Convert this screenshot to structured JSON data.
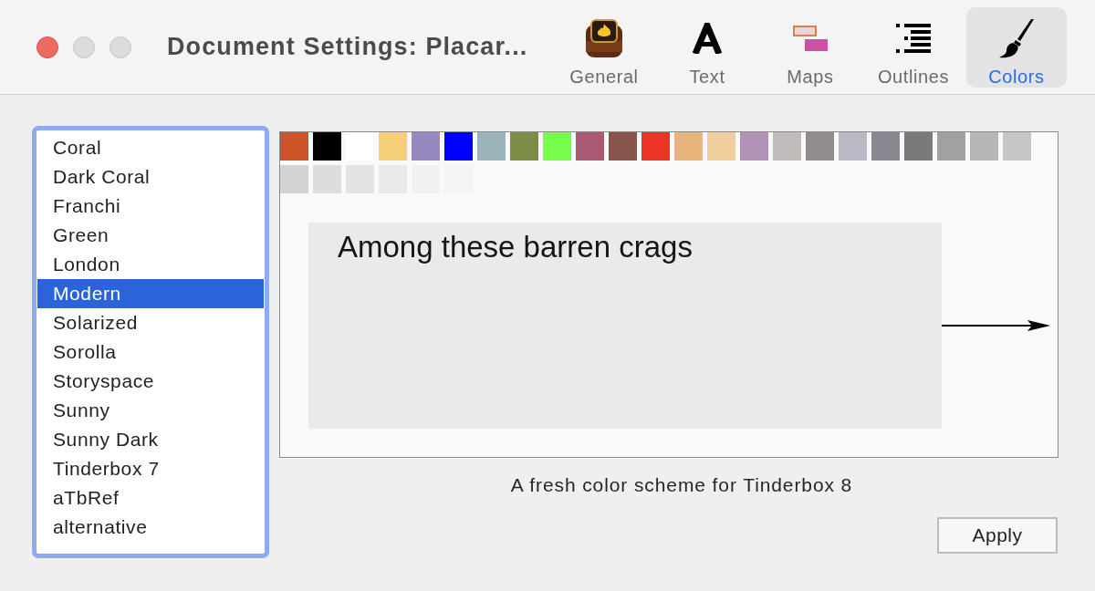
{
  "window": {
    "title": "Document Settings: Placar..."
  },
  "toolbar": {
    "tabs": [
      {
        "label": "General",
        "kind": "app",
        "selected": false
      },
      {
        "label": "Text",
        "kind": "letter",
        "selected": false
      },
      {
        "label": "Maps",
        "kind": "notes",
        "selected": false
      },
      {
        "label": "Outlines",
        "kind": "list",
        "selected": false
      },
      {
        "label": "Colors",
        "kind": "brush",
        "selected": true
      }
    ]
  },
  "scheme_list": {
    "items": [
      {
        "label": "Coral",
        "selected": false
      },
      {
        "label": "Dark Coral",
        "selected": false
      },
      {
        "label": "Franchi",
        "selected": false
      },
      {
        "label": "Green",
        "selected": false
      },
      {
        "label": "London",
        "selected": false
      },
      {
        "label": "Modern",
        "selected": true
      },
      {
        "label": "Solarized",
        "selected": false
      },
      {
        "label": "Sorolla",
        "selected": false
      },
      {
        "label": "Storyspace",
        "selected": false
      },
      {
        "label": "Sunny",
        "selected": false
      },
      {
        "label": "Sunny Dark",
        "selected": false
      },
      {
        "label": "Tinderbox 7",
        "selected": false
      },
      {
        "label": "aTbRef",
        "selected": false
      },
      {
        "label": "alternative",
        "selected": false
      }
    ]
  },
  "preview": {
    "swatches": [
      {
        "color": "#cb5428"
      },
      {
        "color": "#000000"
      },
      {
        "color": "#ffffff"
      },
      {
        "color": "#f7cf78"
      },
      {
        "color": "#9788c0"
      },
      {
        "color": "#0000ff"
      },
      {
        "color": "#9bb4b9"
      },
      {
        "color": "#7d8d47"
      },
      {
        "color": "#76fd4c"
      },
      {
        "color": "#a95a73"
      },
      {
        "color": "#87544c"
      },
      {
        "color": "#ea3526"
      },
      {
        "color": "#e8b47c"
      },
      {
        "color": "#efcd9c"
      },
      {
        "color": "#b192b4"
      },
      {
        "color": "#c1bbbb"
      },
      {
        "color": "#928b8b"
      },
      {
        "color": "#b8b9c4"
      },
      {
        "color": "#898a91"
      },
      {
        "color": "#797a79"
      },
      {
        "color": "#a0a1a2"
      },
      {
        "color": "#b5b6b7"
      },
      {
        "color": "#c5c6c7"
      },
      {
        "color": "#d2d3d4"
      },
      {
        "color": "#dcdddf"
      },
      {
        "color": "#e2e3e5"
      },
      {
        "color": "#e8e9eb"
      },
      {
        "color": "#eff1f2"
      },
      {
        "color": "#f2f4f6"
      }
    ],
    "note": {
      "title": "Among these barren crags"
    }
  },
  "description": "A fresh color scheme for Tinderbox 8",
  "buttons": [
    {
      "label": "Apply"
    }
  ]
}
